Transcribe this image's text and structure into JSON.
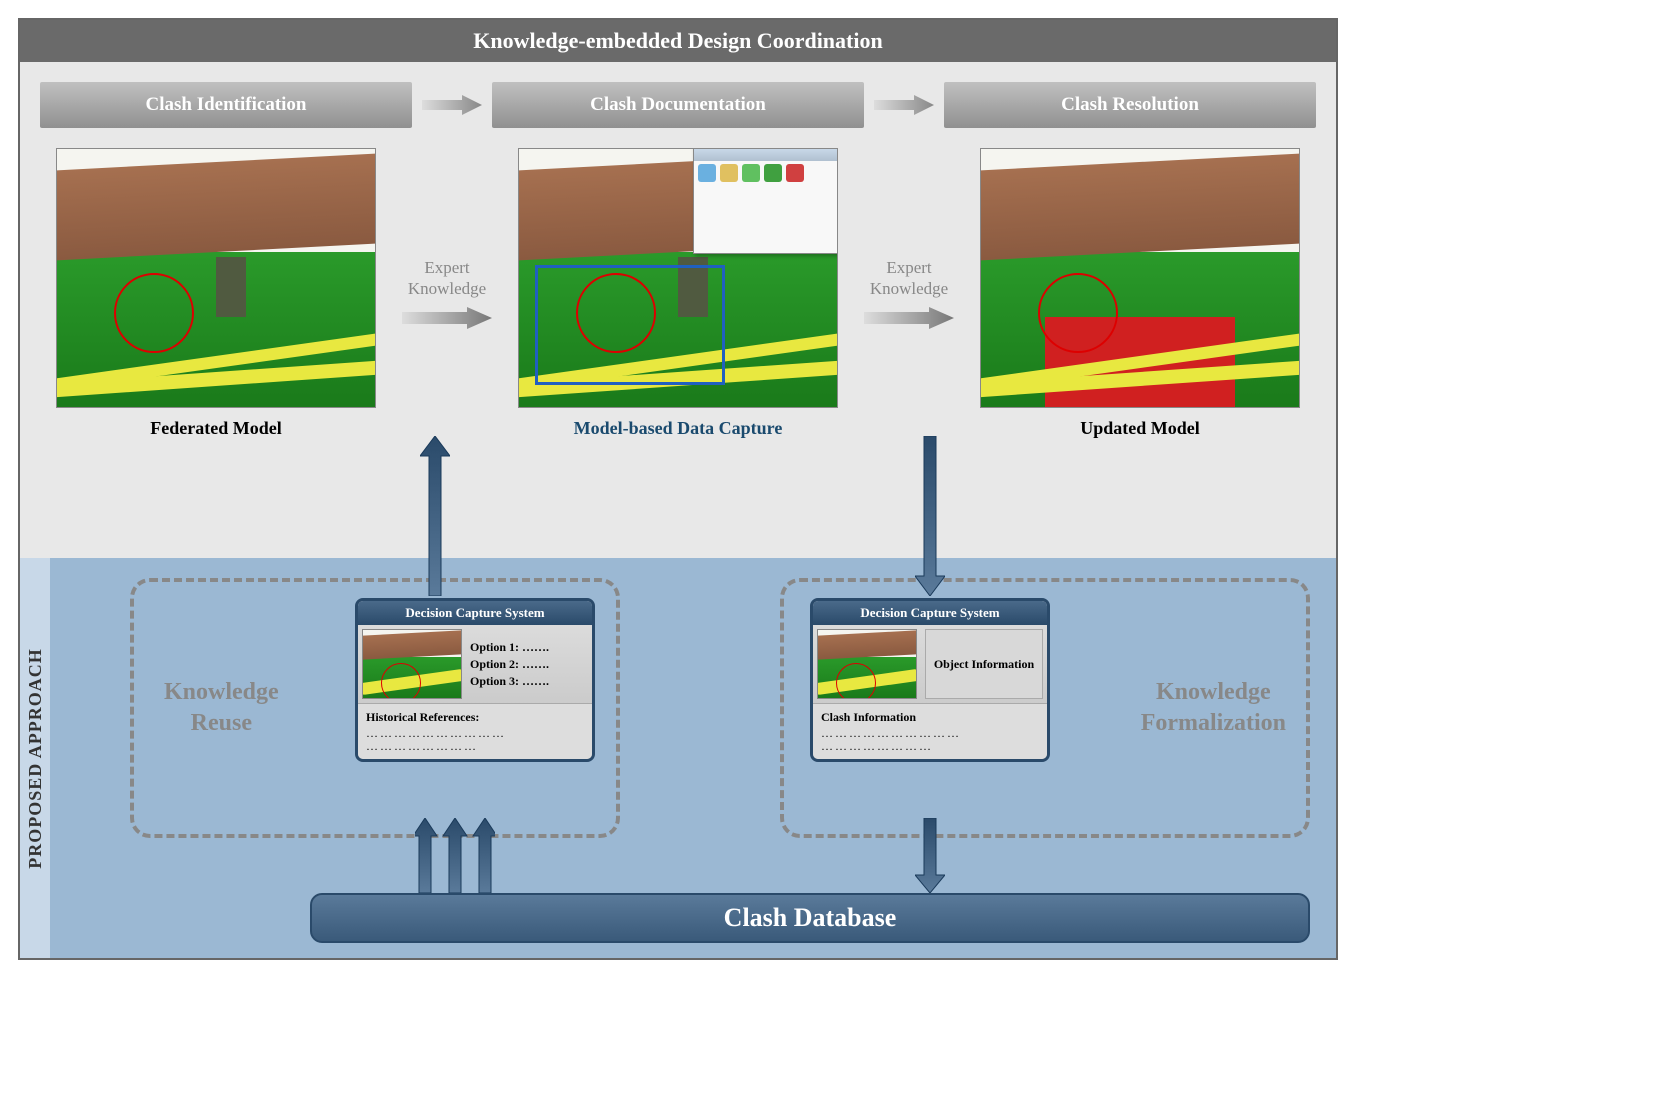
{
  "header": "Knowledge-embedded Design Coordination",
  "stages": {
    "s1": "Clash Identification",
    "s2": "Clash Documentation",
    "s3": "Clash Resolution"
  },
  "expert": {
    "line1": "Expert",
    "line2": "Knowledge"
  },
  "captions": {
    "c1": "Federated Model",
    "c2": "Model-based Data Capture",
    "c3": "Updated Model"
  },
  "sidebar": "PROPOSED APPROACH",
  "knowledge": {
    "reuse_l1": "Knowledge",
    "reuse_l2": "Reuse",
    "form_l1": "Knowledge",
    "form_l2": "Formalization"
  },
  "dcs": {
    "title": "Decision Capture System",
    "opt1": "Option 1: …….",
    "opt2": "Option 2: …….",
    "opt3": "Option 3: …….",
    "hist": "Historical References:",
    "objinfo": "Object Information",
    "clashinfo": "Clash Information",
    "dots1": "…………………………",
    "dots2": "……………………"
  },
  "database": "Clash Database"
}
